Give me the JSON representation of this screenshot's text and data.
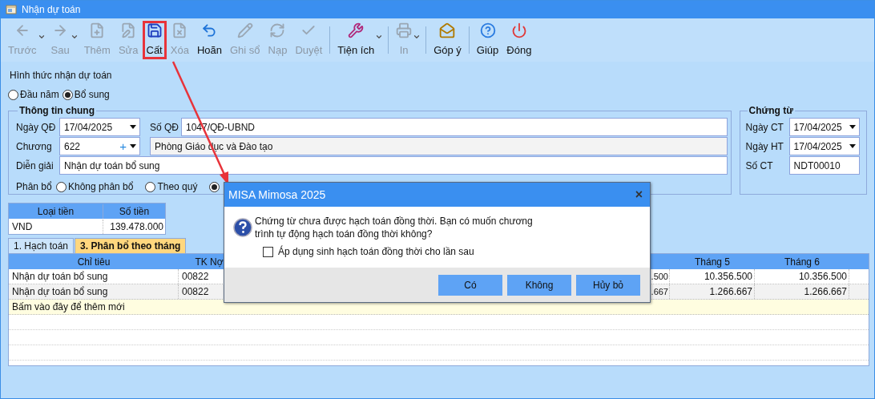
{
  "window": {
    "title": "Nhận dự toán"
  },
  "toolbar": [
    {
      "label": "Trước",
      "enabled": false,
      "dropdown": true,
      "separator_before": false,
      "highlighted": false
    },
    {
      "label": "Sau",
      "enabled": false,
      "dropdown": true,
      "separator_before": false,
      "highlighted": false
    },
    {
      "label": "Thêm",
      "enabled": false,
      "dropdown": false,
      "separator_before": false,
      "highlighted": false
    },
    {
      "label": "Sửa",
      "enabled": false,
      "dropdown": false,
      "separator_before": false,
      "highlighted": false
    },
    {
      "label": "Cất",
      "enabled": true,
      "dropdown": false,
      "separator_before": false,
      "highlighted": true
    },
    {
      "label": "Xóa",
      "enabled": false,
      "dropdown": false,
      "separator_before": false,
      "highlighted": false
    },
    {
      "label": "Hoãn",
      "enabled": true,
      "dropdown": false,
      "separator_before": false,
      "highlighted": false
    },
    {
      "label": "Ghi sổ",
      "enabled": false,
      "dropdown": false,
      "separator_before": false,
      "highlighted": false
    },
    {
      "label": "Nạp",
      "enabled": false,
      "dropdown": false,
      "separator_before": false,
      "highlighted": false
    },
    {
      "label": "Duyệt",
      "enabled": false,
      "dropdown": false,
      "separator_before": false,
      "highlighted": false
    },
    {
      "label": "Tiện ích",
      "enabled": true,
      "dropdown": true,
      "separator_before": true,
      "highlighted": false
    },
    {
      "label": "In",
      "enabled": false,
      "dropdown": true,
      "separator_before": true,
      "highlighted": false
    },
    {
      "label": "Góp ý",
      "enabled": true,
      "dropdown": false,
      "separator_before": true,
      "highlighted": false
    },
    {
      "label": "Giúp",
      "enabled": true,
      "dropdown": false,
      "separator_before": true,
      "highlighted": false
    },
    {
      "label": "Đóng",
      "enabled": true,
      "dropdown": false,
      "separator_before": false,
      "highlighted": false
    }
  ],
  "receive_type": {
    "label": "Hình thức nhận dự toán",
    "options": [
      {
        "label": "Đầu năm",
        "selected": false
      },
      {
        "label": "Bổ sung",
        "selected": true
      }
    ]
  },
  "general_info": {
    "title": "Thông tin chung",
    "decision_date": {
      "label": "Ngày QĐ",
      "value": "17/04/2025"
    },
    "decision_no": {
      "label": "Số QĐ",
      "value": "1047/QĐ-UBND"
    },
    "chapter": {
      "label": "Chương",
      "value": "622",
      "plus": "+",
      "name": "Phòng Giáo dục và Đào tạo"
    },
    "description": {
      "label": "Diễn giải",
      "value": "Nhận dự toán bổ sung"
    },
    "allocation": {
      "label": "Phân bổ",
      "options": [
        {
          "label": "Không phân bổ",
          "selected": false
        },
        {
          "label": "Theo quý",
          "selected": false
        },
        {
          "selected": true
        }
      ]
    }
  },
  "voucher": {
    "title": "Chứng từ",
    "voucher_date": {
      "label": "Ngày CT",
      "value": "17/04/2025"
    },
    "posting_date": {
      "label": "Ngày HT",
      "value": "17/04/2025"
    },
    "voucher_no": {
      "label": "Số CT",
      "value": "NDT00010"
    }
  },
  "currency_table": {
    "columns": [
      "Loại tiền",
      "Số tiền"
    ],
    "rows": [
      {
        "currency": "VND",
        "amount": "139.478.000"
      }
    ]
  },
  "tabs": [
    {
      "label": "1. Hạch toán",
      "selected": false
    },
    {
      "label": "3. Phân bổ theo tháng",
      "selected": true
    }
  ],
  "grid": {
    "columns": [
      "Chỉ tiêu",
      "TK Nợ",
      "Tháng 5",
      "Tháng 6"
    ],
    "rows": [
      {
        "chi_tieu": "Nhận dự toán bổ sung",
        "tk_no": "00822",
        "column_3": ".500",
        "thang_5": "10.356.500",
        "thang_6": "10.356.500"
      },
      {
        "chi_tieu": "Nhận dự toán bổ sung",
        "tk_no": "00822",
        "column_3": ".667",
        "thang_5": "1.266.667",
        "thang_6": "1.266.667"
      }
    ],
    "add_row": "Bấm vào đây để thêm mới"
  },
  "dialog": {
    "title": "MISA Mimosa 2025",
    "close": "×",
    "message": "Chứng từ chưa được hạch toán đồng thời. Bạn có muốn chương trình tự động hạch toán đồng thời không?",
    "checkbox": {
      "label": "Áp dụng sinh hạch toán đồng thời cho lần sau",
      "checked": false
    },
    "buttons": [
      "Có",
      "Không",
      "Hủy bỏ"
    ]
  }
}
